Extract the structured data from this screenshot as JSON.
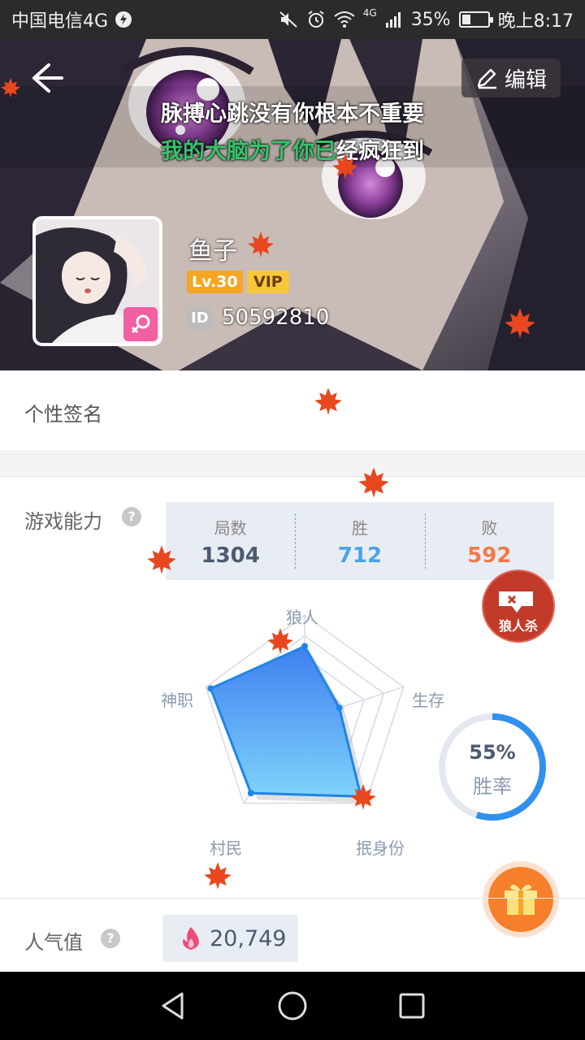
{
  "status_bar": {
    "carrier": "中国电信4G",
    "signal_label": "4G",
    "battery": "35%",
    "time": "晚上8:17",
    "battery_level": 0.35
  },
  "header": {
    "edit_label": "编辑",
    "lyric_line1": "脉搏心跳没有你根本不重要",
    "lyric_line2_sung": "我的大脑为了你已",
    "lyric_line2_rest": "经疯狂到",
    "username": "鱼子",
    "level": "Lv.30",
    "vip": "VIP",
    "id_label": "ID",
    "id_number": "50592810"
  },
  "signature": {
    "label": "个性签名"
  },
  "game": {
    "label": "游戏能力",
    "help": "?",
    "stats": [
      {
        "label": "局数",
        "value": "1304",
        "color": "#4b5a70"
      },
      {
        "label": "胜",
        "value": "712",
        "color": "#4aa3e8"
      },
      {
        "label": "败",
        "value": "592",
        "color": "#f07a4a"
      }
    ],
    "stamp_text": "狼人杀",
    "radar": {
      "axes": [
        "狼人",
        "生存",
        "抿身份",
        "村民",
        "神职"
      ],
      "values": [
        0.7,
        0.35,
        0.92,
        0.88,
        0.95
      ]
    },
    "winrate": {
      "percent": "55%",
      "label": "胜率",
      "value": 0.55
    }
  },
  "popularity": {
    "label": "人气值",
    "help": "?",
    "value": "20,749"
  },
  "colors": {
    "accent": "#2f90f0",
    "orange": "#f57f2b",
    "panel": "#e8ecf3"
  }
}
